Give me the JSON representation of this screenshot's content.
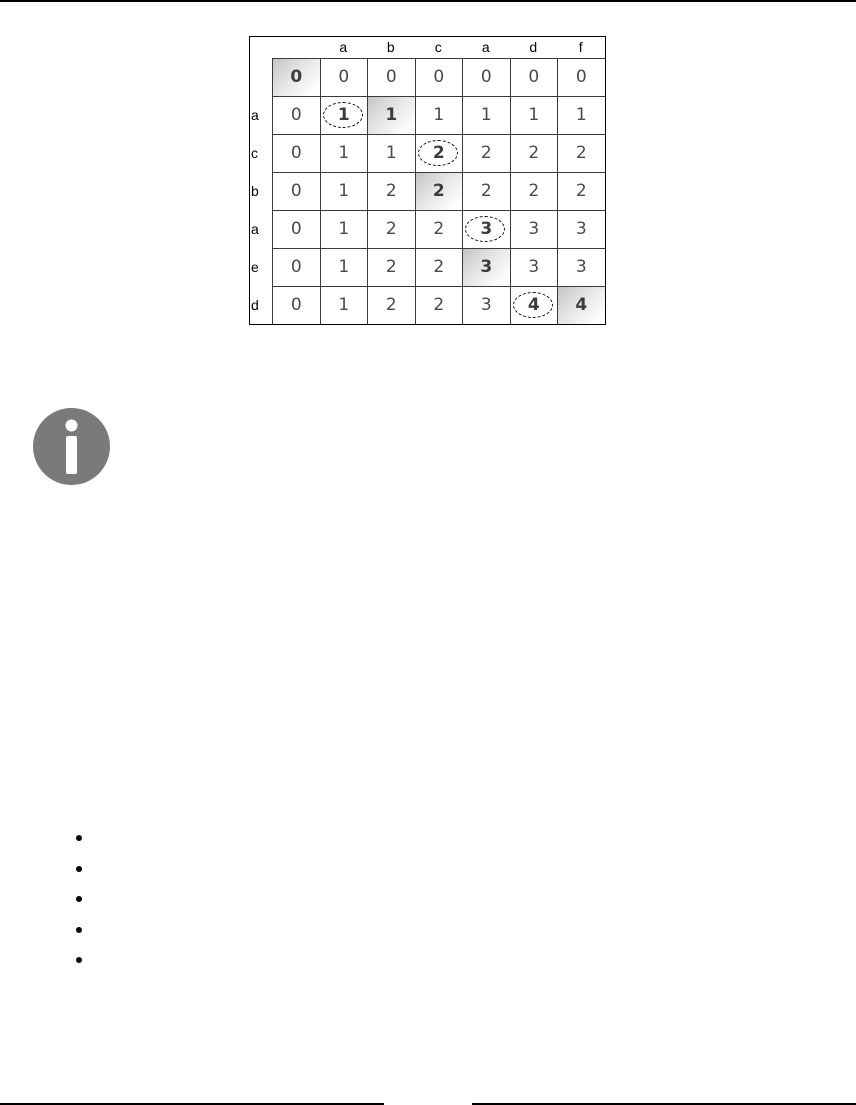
{
  "lcs_table": {
    "column_headers": [
      "a",
      "b",
      "c",
      "a",
      "d",
      "f"
    ],
    "row_headers": [
      "a",
      "c",
      "b",
      "a",
      "e",
      "d"
    ],
    "rows": [
      [
        "0",
        "0",
        "0",
        "0",
        "0",
        "0",
        "0"
      ],
      [
        "0",
        "1",
        "1",
        "1",
        "1",
        "1",
        "1"
      ],
      [
        "0",
        "1",
        "1",
        "2",
        "2",
        "2",
        "2"
      ],
      [
        "0",
        "1",
        "2",
        "2",
        "2",
        "2",
        "2"
      ],
      [
        "0",
        "1",
        "2",
        "2",
        "3",
        "3",
        "3"
      ],
      [
        "0",
        "1",
        "2",
        "2",
        "3",
        "3",
        "3"
      ],
      [
        "0",
        "1",
        "2",
        "2",
        "3",
        "4",
        "4"
      ]
    ],
    "path_cells": [
      [
        0,
        0
      ],
      [
        1,
        1
      ],
      [
        1,
        2
      ],
      [
        2,
        3
      ],
      [
        3,
        3
      ],
      [
        4,
        4
      ],
      [
        5,
        4
      ],
      [
        6,
        5
      ],
      [
        6,
        6
      ]
    ],
    "circled_cells": [
      [
        1,
        1
      ],
      [
        2,
        3
      ],
      [
        4,
        4
      ],
      [
        6,
        5
      ]
    ]
  },
  "info_icon": {
    "icon": "info-icon",
    "color": "#7a7a7a"
  },
  "bullet_list": {
    "count": 5
  }
}
